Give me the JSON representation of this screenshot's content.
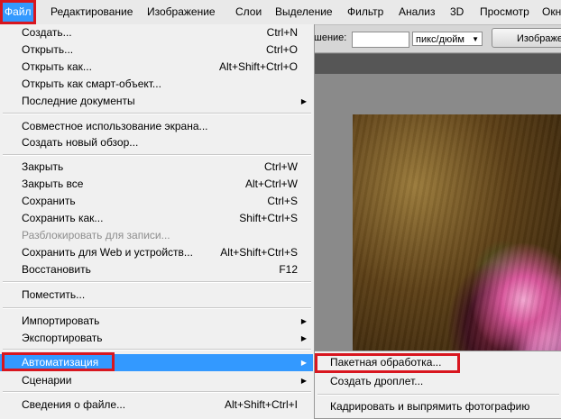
{
  "menubar": {
    "items": [
      "Файл",
      "Редактирование",
      "Изображение",
      "Слои",
      "Выделение",
      "Фильтр",
      "Анализ",
      "3D",
      "Просмотр",
      "Окн"
    ]
  },
  "options": {
    "resolution_label": "шение:",
    "resolution_value": "",
    "unit_select": "пикс/дюйм",
    "image_button": "Изображе"
  },
  "file_menu": {
    "items": [
      {
        "label": "Создать...",
        "shortcut": "Ctrl+N"
      },
      {
        "label": "Открыть...",
        "shortcut": "Ctrl+O"
      },
      {
        "label": "Открыть как...",
        "shortcut": "Alt+Shift+Ctrl+O"
      },
      {
        "label": "Открыть как смарт-объект...",
        "shortcut": ""
      },
      {
        "label": "Последние документы",
        "shortcut": ""
      },
      {
        "label": "Совместное использование экрана...",
        "shortcut": ""
      },
      {
        "label": "Создать новый обзор...",
        "shortcut": ""
      },
      {
        "label": "Закрыть",
        "shortcut": "Ctrl+W"
      },
      {
        "label": "Закрыть все",
        "shortcut": "Alt+Ctrl+W"
      },
      {
        "label": "Сохранить",
        "shortcut": "Ctrl+S"
      },
      {
        "label": "Сохранить как...",
        "shortcut": "Shift+Ctrl+S"
      },
      {
        "label": "Разблокировать для записи...",
        "shortcut": ""
      },
      {
        "label": "Сохранить для Web и устройств...",
        "shortcut": "Alt+Shift+Ctrl+S"
      },
      {
        "label": "Восстановить",
        "shortcut": "F12"
      },
      {
        "label": "Поместить...",
        "shortcut": ""
      },
      {
        "label": "Импортировать",
        "shortcut": ""
      },
      {
        "label": "Экспортировать",
        "shortcut": ""
      },
      {
        "label": "Автоматизация",
        "shortcut": ""
      },
      {
        "label": "Сценарии",
        "shortcut": ""
      },
      {
        "label": "Сведения о файле...",
        "shortcut": "Alt+Shift+Ctrl+I"
      }
    ]
  },
  "automation_submenu": {
    "items": [
      "Пакетная обработка...",
      "Создать дроплет...",
      "Кадрировать и выпрямить фотографию"
    ]
  },
  "colors": {
    "highlight": "#3399ff",
    "annotation_border": "#d8161f",
    "menu_bg": "#f0f0f0"
  }
}
